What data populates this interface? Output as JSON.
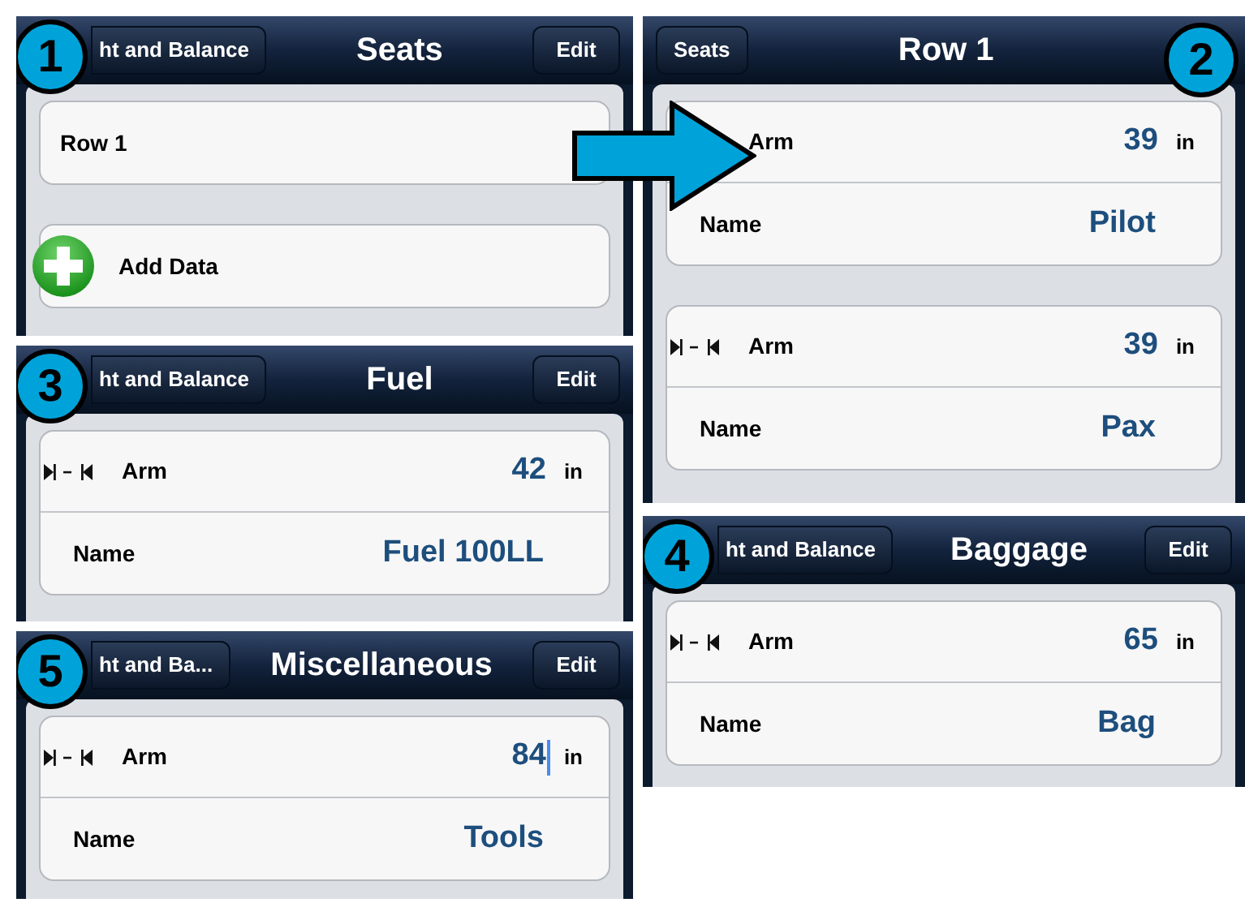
{
  "panels": [
    {
      "callout": {
        "number": "1",
        "at_right": false
      },
      "back": "ht and Balance",
      "title": "Seats",
      "edit": "Edit",
      "cards": [
        {
          "rows": [
            {
              "kind": "link",
              "label": "Row 1"
            }
          ]
        },
        {
          "rows": [
            {
              "kind": "add",
              "label": "Add Data"
            }
          ]
        }
      ]
    },
    {
      "callout": {
        "number": "3",
        "at_right": false
      },
      "back": "ht and Balance",
      "title": "Fuel",
      "edit": "Edit",
      "cards": [
        {
          "rows": [
            {
              "kind": "arm",
              "icon": true,
              "label": "Arm",
              "value": "42",
              "unit": "in",
              "cursor": false
            },
            {
              "kind": "name",
              "label": "Name",
              "value": "Fuel 100LL"
            }
          ]
        }
      ]
    },
    {
      "callout": {
        "number": "5",
        "at_right": false
      },
      "back": "ht and Ba...",
      "title": "Miscellaneous",
      "edit": "Edit",
      "cards": [
        {
          "rows": [
            {
              "kind": "arm",
              "icon": true,
              "label": "Arm",
              "value": "84",
              "unit": "in",
              "cursor": true
            },
            {
              "kind": "name",
              "label": "Name",
              "value": "Tools"
            }
          ]
        }
      ]
    },
    {
      "callout": {
        "number": "2",
        "at_right": true
      },
      "back": "Seats",
      "title": "Row 1",
      "cards": [
        {
          "rows": [
            {
              "kind": "arm",
              "icon": false,
              "label": "Arm",
              "value": "39",
              "unit": "in",
              "cursor": false
            },
            {
              "kind": "name",
              "label": "Name",
              "value": "Pilot"
            }
          ]
        },
        {
          "rows": [
            {
              "kind": "arm",
              "icon": true,
              "label": "Arm",
              "value": "39",
              "unit": "in",
              "cursor": false
            },
            {
              "kind": "name",
              "label": "Name",
              "value": "Pax"
            }
          ]
        }
      ]
    },
    {
      "callout": {
        "number": "4",
        "at_right": false
      },
      "back": "ht and Balance",
      "title": "Baggage",
      "edit": "Edit",
      "cards": [
        {
          "rows": [
            {
              "kind": "arm",
              "icon": true,
              "label": "Arm",
              "value": "65",
              "unit": "in",
              "cursor": false
            },
            {
              "kind": "name",
              "label": "Name",
              "value": "Bag"
            }
          ]
        }
      ]
    }
  ]
}
